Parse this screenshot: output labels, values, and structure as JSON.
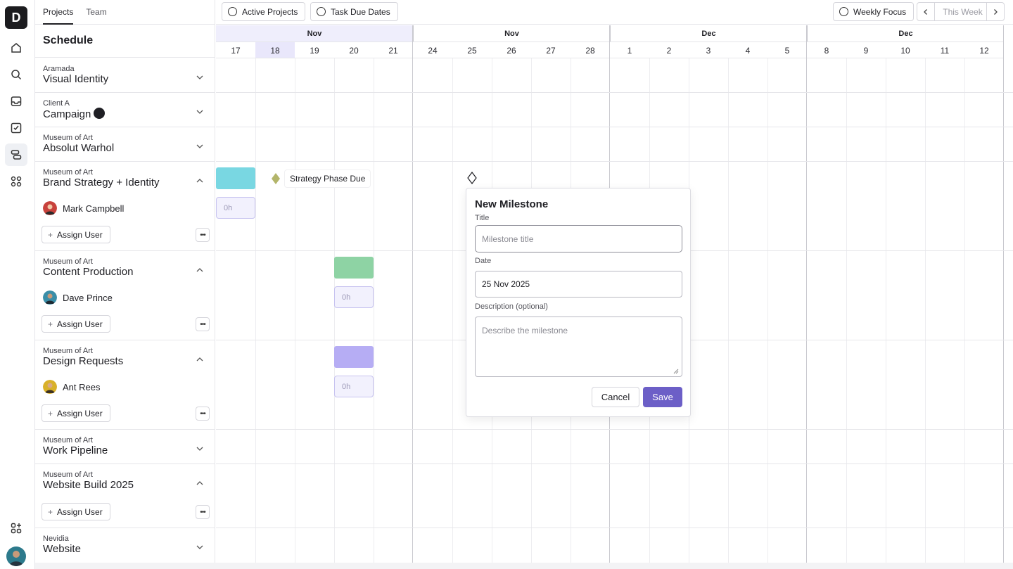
{
  "sidebar_tabs": [
    {
      "label": "Projects",
      "active": true
    },
    {
      "label": "Team",
      "active": false
    }
  ],
  "schedule_title": "Schedule",
  "projects": [
    {
      "client": "Aramada",
      "name": "Visual Identity",
      "expanded": false
    },
    {
      "client": "Client A",
      "name": "Campaign",
      "expanded": false
    },
    {
      "client": "Museum of Art",
      "name": "Absolut Warhol",
      "expanded": false
    },
    {
      "client": "Museum of Art",
      "name": "Brand Strategy + Identity",
      "expanded": true,
      "user": "Mark Campbell"
    },
    {
      "client": "Museum of Art",
      "name": "Content Production",
      "expanded": true,
      "user": "Dave Prince"
    },
    {
      "client": "Museum of Art",
      "name": "Design Requests",
      "expanded": true,
      "user": "Ant Rees"
    },
    {
      "client": "Museum of Art",
      "name": "Work Pipeline",
      "expanded": false
    },
    {
      "client": "Museum of Art",
      "name": "Website Build 2025",
      "expanded": true
    },
    {
      "client": "Nevidia",
      "name": "Website",
      "expanded": false
    }
  ],
  "assign_user_label": "Assign User",
  "more_label": "•••",
  "toolbar": {
    "active_projects": "Active Projects",
    "task_due_dates": "Task Due Dates",
    "weekly_focus": "Weekly Focus",
    "this_week": "This Week"
  },
  "timeline": {
    "months": [
      "Nov",
      "Nov",
      "Dec",
      "Dec"
    ],
    "days": [
      "17",
      "18",
      "19",
      "20",
      "21",
      "24",
      "25",
      "26",
      "27",
      "28",
      "1",
      "2",
      "3",
      "4",
      "5",
      "8",
      "9",
      "10",
      "11",
      "12"
    ],
    "highlighted_day": "18",
    "hours_placeholder": "0h",
    "milestone_label": "Strategy Phase Due"
  },
  "colors": {
    "accent": "#6c5fc7",
    "bar_cyan": "#79d7e2",
    "bar_green": "#8ed3a4",
    "bar_purple": "#b6adf4",
    "milestone_olive": "#b3b56a"
  },
  "popover": {
    "title": "New Milestone",
    "title_label": "Title",
    "title_placeholder": "Milestone title",
    "date_label": "Date",
    "date_value": "25 Nov 2025",
    "description_label": "Description (optional)",
    "description_placeholder": "Describe the milestone",
    "cancel": "Cancel",
    "save": "Save"
  }
}
